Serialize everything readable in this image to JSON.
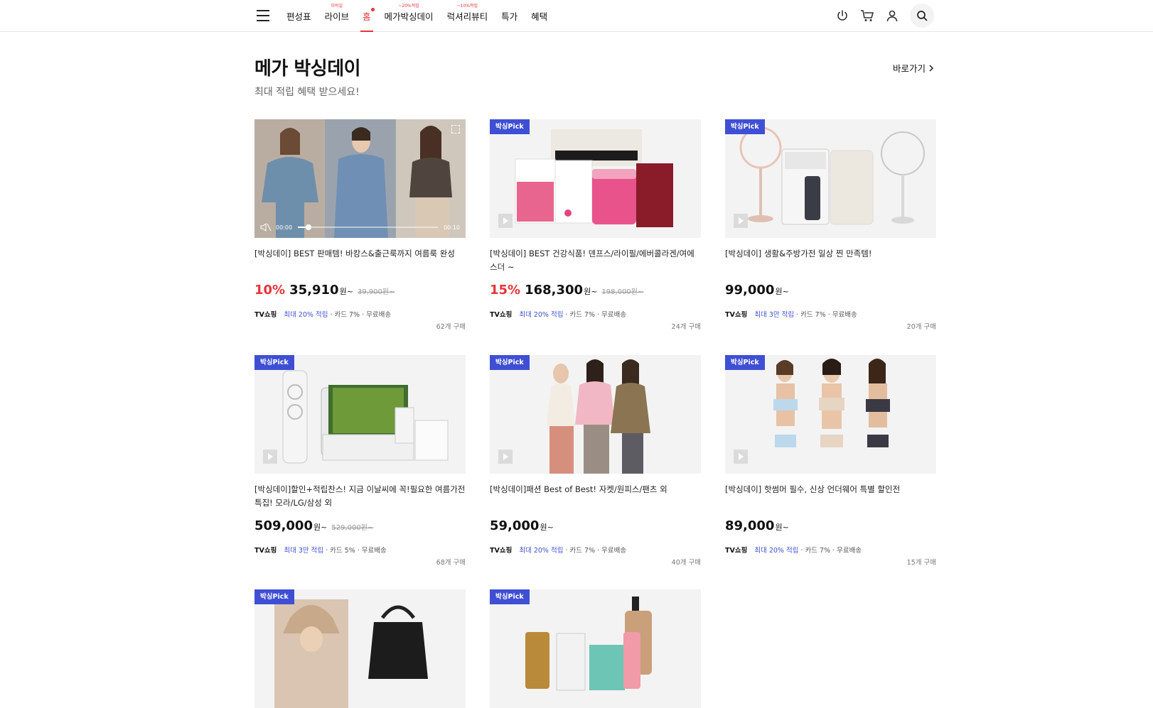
{
  "nav": {
    "items": [
      {
        "label": "편성표",
        "badge": ""
      },
      {
        "label": "라이브",
        "badge": "모바일"
      },
      {
        "label": "홈",
        "badge": "",
        "active": true
      },
      {
        "label": "메가박싱데이",
        "badge": "~20%적립"
      },
      {
        "label": "럭셔리뷰티",
        "badge": "~10%적립"
      },
      {
        "label": "특가",
        "badge": ""
      },
      {
        "label": "혜택",
        "badge": ""
      }
    ]
  },
  "section": {
    "title": "메가 박싱데이",
    "subtitle": "최대 적립 혜택 받으세요!",
    "goto": "바로가기"
  },
  "common": {
    "tv": "TV쇼핑",
    "won": "원",
    "tilde": "~",
    "pick": "박싱Pick"
  },
  "products": [
    {
      "title": "[박싱데이] BEST 판매템! 바캉스&출근룩까지 여름룩 완성",
      "rate": "10%",
      "price": "35,910",
      "orig": "39,900",
      "benefit": "최대 20% 적립",
      "card": " · 카드 7% · 무료배송",
      "count": "62개 구매",
      "video": true,
      "time_start": "00:00",
      "time_end": "00:10"
    },
    {
      "title": "[박싱데이] BEST 건강식품! 덴프스/라이필/에버콜라겐/여에스더 ~",
      "rate": "15%",
      "price": "168,300",
      "orig": "198,000",
      "benefit": "최대 20% 적립",
      "card": " · 카드 7% · 무료배송",
      "count": "24개 구매"
    },
    {
      "title": "[박싱데이] 생활&주방가전 일상 찐 만족템!",
      "rate": "",
      "price": "99,000",
      "orig": "",
      "benefit": "최대 3만 적립",
      "card": " · 카드 7% · 무료배송",
      "count": "20개 구매"
    },
    {
      "title": "[박싱데이]할인+적립찬스! 지금 이날씨에 꼭!필요한 여름가전 특집! 모라/LG/삼성 외",
      "rate": "",
      "price": "509,000",
      "orig": "529,000",
      "benefit": "최대 3만 적립",
      "card": " · 카드 5% · 무료배송",
      "count": "68개 구매"
    },
    {
      "title": "[박싱데이]패션 Best of Best! 자켓/원피스/팬츠 외",
      "rate": "",
      "price": "59,000",
      "orig": "",
      "benefit": "최대 20% 적립",
      "card": " · 카드 7% · 무료배송",
      "count": "40개 구매"
    },
    {
      "title": "[박싱데이] 핫썸머 필수, 신상 언더웨어 특별 할인전",
      "rate": "",
      "price": "89,000",
      "orig": "",
      "benefit": "최대 20% 적립",
      "card": " · 카드 7% · 무료배송",
      "count": "15개 구매"
    },
    {
      "title": "",
      "rate": "",
      "price": "",
      "orig": ""
    },
    {
      "title": "",
      "rate": "",
      "price": "",
      "orig": ""
    }
  ],
  "colors": {
    "accent": "#e8333a",
    "pick": "#3f4fd4"
  }
}
